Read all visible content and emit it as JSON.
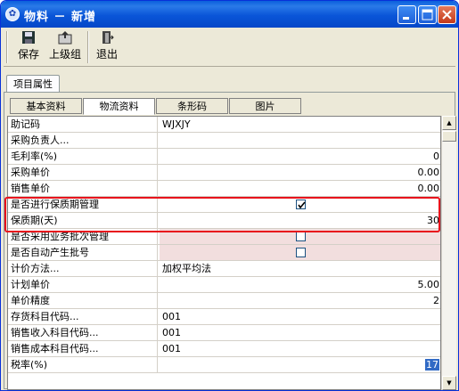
{
  "window": {
    "title": "物料 － 新增"
  },
  "toolbar": {
    "save": "保存",
    "parent_group": "上级组",
    "exit": "退出"
  },
  "tabs": {
    "main": "项目属性",
    "sub": [
      "基本资料",
      "物流资料",
      "条形码",
      "图片"
    ],
    "active_sub": 1
  },
  "rows": [
    {
      "label": "助记码",
      "value": "WJXJY",
      "align": "left",
      "type": "text"
    },
    {
      "label": "采购负责人...",
      "value": "",
      "align": "left",
      "type": "text"
    },
    {
      "label": "毛利率(%)",
      "value": "0",
      "align": "right",
      "type": "text"
    },
    {
      "label": "采购单价",
      "value": "0.00",
      "align": "right",
      "type": "text"
    },
    {
      "label": "销售单价",
      "value": "0.00",
      "align": "right",
      "type": "text"
    },
    {
      "label": "是否进行保质期管理",
      "value": "",
      "type": "checkbox",
      "checked": true
    },
    {
      "label": "保质期(天)",
      "value": "30",
      "align": "right",
      "type": "text"
    },
    {
      "label": "是否采用业务批次管理",
      "value": "",
      "type": "checkbox",
      "checked": false,
      "pink": true
    },
    {
      "label": "是否自动产生批号",
      "value": "",
      "type": "checkbox",
      "checked": false,
      "pink": true
    },
    {
      "label": "计价方法...",
      "value": "加权平均法",
      "align": "left",
      "type": "text"
    },
    {
      "label": "计划单价",
      "value": "5.00",
      "align": "right",
      "type": "text"
    },
    {
      "label": "单价精度",
      "value": "2",
      "align": "right",
      "type": "text"
    },
    {
      "label": "存货科目代码...",
      "value": "001",
      "align": "left",
      "type": "text"
    },
    {
      "label": "销售收入科目代码...",
      "value": "001",
      "align": "left",
      "type": "text"
    },
    {
      "label": "销售成本科目代码...",
      "value": "001",
      "align": "left",
      "type": "text"
    },
    {
      "label": "税率(%)",
      "value": "17",
      "align": "right",
      "type": "text",
      "selected": true
    }
  ],
  "colors": {
    "highlight_box": "#e8131c",
    "selection": "#316ac5",
    "titlebar": "#0a55d8"
  }
}
